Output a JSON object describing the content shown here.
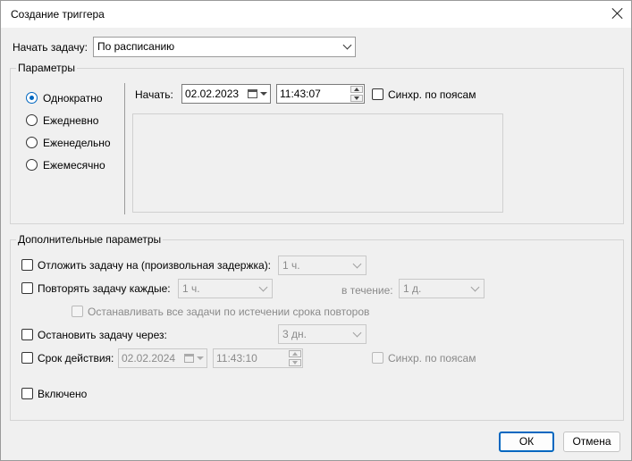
{
  "window": {
    "title": "Создание триггера"
  },
  "start_task": {
    "label": "Начать задачу:",
    "value": "По расписанию"
  },
  "params": {
    "group_label": "Параметры",
    "radios": [
      {
        "label": "Однократно",
        "selected": true
      },
      {
        "label": "Ежедневно",
        "selected": false
      },
      {
        "label": "Еженедельно",
        "selected": false
      },
      {
        "label": "Ежемесячно",
        "selected": false
      }
    ],
    "start_label": "Начать:",
    "start_date": "02.02.2023",
    "start_time": "11:43:07",
    "sync_label": "Синхр. по поясам"
  },
  "advanced": {
    "group_label": "Дополнительные параметры",
    "delay_label": "Отложить задачу на (произвольная задержка):",
    "delay_value": "1 ч.",
    "repeat_label": "Повторять задачу каждые:",
    "repeat_value": "1 ч.",
    "duration_label": "в течение:",
    "duration_value": "1 д.",
    "stop_all_label": "Останавливать все задачи по истечении срока повторов",
    "stop_after_label": "Остановить задачу через:",
    "stop_after_value": "3 дн.",
    "expire_label": "Срок действия:",
    "expire_date": "02.02.2024",
    "expire_time": "11:43:10",
    "expire_sync_label": "Синхр. по поясам",
    "enabled_label": "Включено"
  },
  "buttons": {
    "ok": "ОК",
    "cancel": "Отмена"
  },
  "colors": {
    "accent": "#0067c0",
    "background": "#f0f0f0"
  }
}
